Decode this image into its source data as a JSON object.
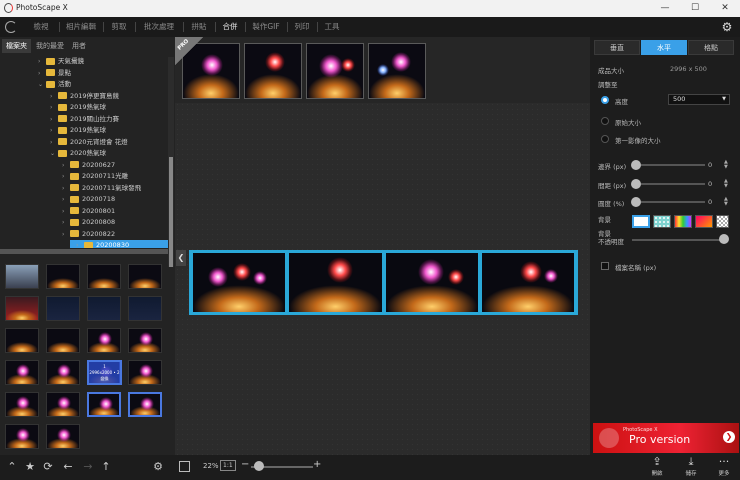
{
  "window": {
    "title": "PhotoScape X",
    "minimize": "—",
    "maximize": "☐",
    "close": "✕"
  },
  "menu": {
    "tabs": [
      {
        "label": "檢視"
      },
      {
        "label": "相片編輯"
      },
      {
        "label": "剪取"
      },
      {
        "label": "批次處理"
      },
      {
        "label": "拼貼"
      },
      {
        "label": "合併"
      },
      {
        "label": "製作GIF"
      },
      {
        "label": "列印"
      },
      {
        "label": "工具"
      }
    ],
    "active_index": 5
  },
  "left": {
    "tabs": [
      "檔案夾",
      "我的最愛",
      "用者"
    ],
    "tree": [
      {
        "label": "天氣攝鏡",
        "indent": 2,
        "expanded": false
      },
      {
        "label": "景點",
        "indent": 2,
        "expanded": false
      },
      {
        "label": "活動",
        "indent": 2,
        "expanded": true
      },
      {
        "label": "2019停更寶島競",
        "indent": 3,
        "expanded": false
      },
      {
        "label": "2019熱氣球",
        "indent": 3,
        "expanded": false
      },
      {
        "label": "2019關山拉力賽",
        "indent": 3,
        "expanded": false
      },
      {
        "label": "2019熱氣球",
        "indent": 3,
        "expanded": false
      },
      {
        "label": "2020元宵燈會 花燈",
        "indent": 3,
        "expanded": false
      },
      {
        "label": "2020熱氣球",
        "indent": 3,
        "expanded": true
      },
      {
        "label": "20200627",
        "indent": 4,
        "expanded": false
      },
      {
        "label": "20200711光雕",
        "indent": 4,
        "expanded": false
      },
      {
        "label": "20200711氣球發飛",
        "indent": 4,
        "expanded": false
      },
      {
        "label": "20200718",
        "indent": 4,
        "expanded": false
      },
      {
        "label": "20200801",
        "indent": 4,
        "expanded": false
      },
      {
        "label": "20200808",
        "indent": 4,
        "expanded": false
      },
      {
        "label": "20200822",
        "indent": 4,
        "expanded": false
      },
      {
        "label": "20200830",
        "indent": 4,
        "expanded": false,
        "selected": true
      }
    ],
    "thumbnail_overlay": {
      "line1": "1",
      "line2": "2996x2000 • 2",
      "line3": "變換"
    }
  },
  "center": {
    "pro_badge": "PRO",
    "collapse_icon": "chevron-left-icon"
  },
  "right": {
    "tabs": [
      "垂直",
      "水平",
      "格點"
    ],
    "active_tab": 1,
    "output_size_label": "成品大小",
    "output_size_value": "2996 x 500",
    "adjust_label": "調整至",
    "height_option": "高度",
    "height_value": "500",
    "original_option": "原始大小",
    "first_image_option": "第一影像的大小",
    "border_label": "邊界 (px)",
    "border_value": "0",
    "spacing_label": "間距 (px)",
    "spacing_value": "0",
    "radius_label": "圓度 (%)",
    "radius_value": "0",
    "background_label": "背景",
    "opacity_label": "背景\n不透明度",
    "filename_label": "檔案名稱 (px)",
    "ad_small": "PhotoScape X",
    "ad_text": "Pro version"
  },
  "bottom": {
    "zoom": "22%",
    "one_to_one": "1:1",
    "minus": "−",
    "plus": "+",
    "apply_label": "開啟",
    "save_label": "儲存",
    "more_label": "更多"
  },
  "colors": {
    "accent": "#3aa0e8",
    "border_highlight": "#2aa8d8",
    "folder": "#e6b83b"
  }
}
